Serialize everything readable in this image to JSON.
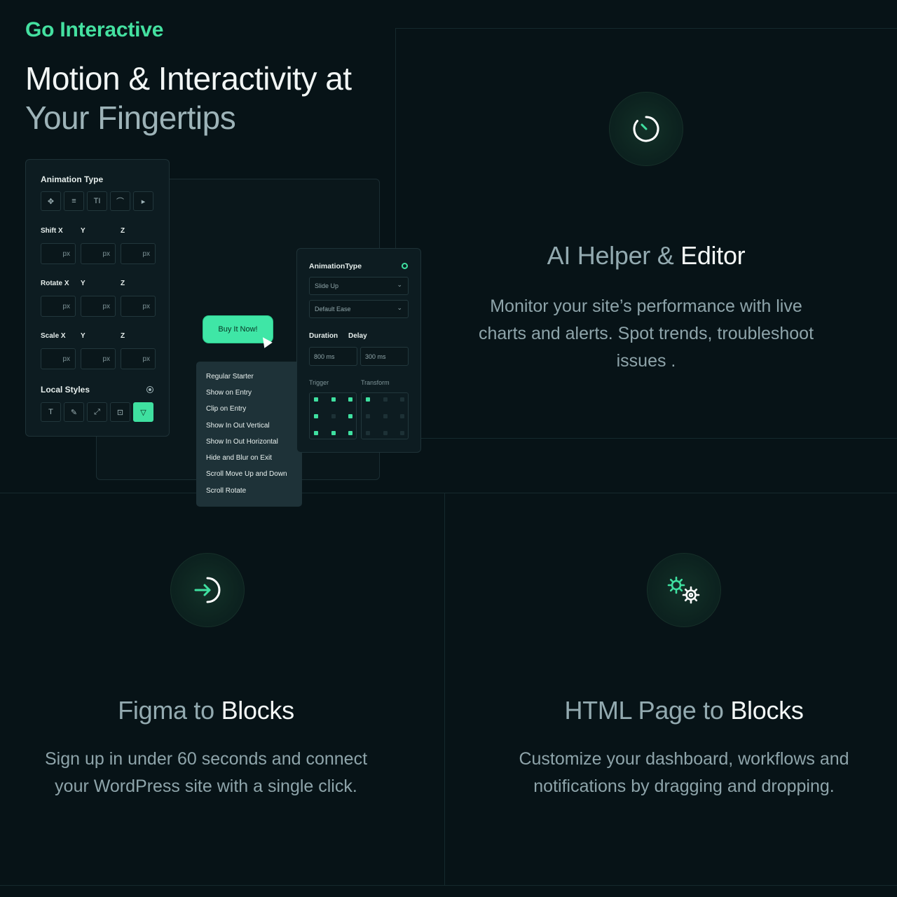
{
  "hero": {
    "eyebrow": "Go Interactive",
    "title_line1": "Motion & Interactivity at",
    "title_line2": "Your Fingertips"
  },
  "animation_panel": {
    "title": "Animation Type",
    "type_icons": [
      "move-icon",
      "align-icon",
      "text-size-icon",
      "bezier-icon",
      "pointer-icon"
    ],
    "shift_label": "Shift X",
    "rotate_label": "Rotate X",
    "scale_label": "Scale X",
    "y_label": "Y",
    "z_label": "Z",
    "unit": "px",
    "local_styles_label": "Local Styles",
    "style_icons": [
      "text-icon",
      "pen-icon",
      "resize-icon",
      "frame-icon",
      "filter-icon"
    ]
  },
  "cta": {
    "buy_label": "Buy It Now!"
  },
  "menu": {
    "items": [
      "Regular Starter",
      "Show on Entry",
      "Clip on Entry",
      "Show In Out Vertical",
      "Show In Out Horizontal",
      "Hide and Blur on Exit",
      "Scroll Move Up and Down",
      "Scroll Rotate"
    ]
  },
  "settings_panel": {
    "title": "AnimationType",
    "animation_select": "Slide Up",
    "ease_select": "Default Ease",
    "duration_label": "Duration",
    "delay_label": "Delay",
    "duration_value": "800 ms",
    "delay_value": "300 ms",
    "trigger_label": "Trigger",
    "transform_label": "Transform",
    "accent": "#3fe0a0"
  },
  "features": {
    "ai": {
      "title_muted": "AI Helper & ",
      "title_strong": "Editor",
      "desc_line1": "Monitor your site’s performance with live",
      "desc_line2": "charts and alerts. Spot trends, troubleshoot",
      "desc_line3": "issues .",
      "icon": "timer-icon"
    },
    "figma": {
      "title_muted": "Figma to ",
      "title_strong": "Blocks",
      "desc_line1": "Sign up in under 60 seconds and connect",
      "desc_line2": "your WordPress site with a single click.",
      "icon": "login-arrow-icon"
    },
    "html": {
      "title_muted": "HTML Page to ",
      "title_strong": "Blocks",
      "desc_line1": "Customize your dashboard, workflows and",
      "desc_line2": "notifications by dragging and dropping.",
      "icon": "gears-icon"
    }
  }
}
